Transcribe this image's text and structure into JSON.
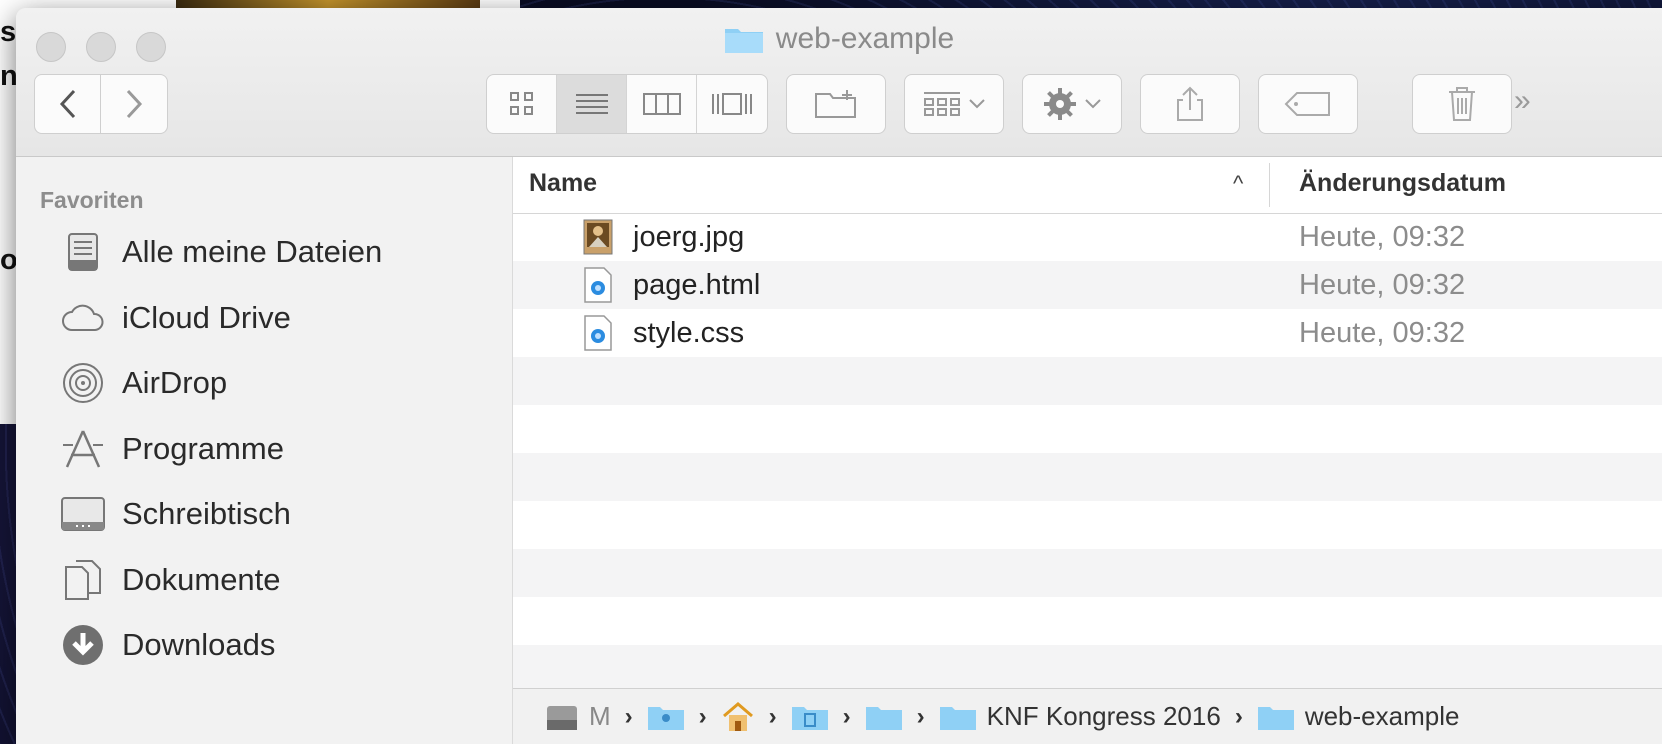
{
  "window": {
    "title": "web-example"
  },
  "background_text": [
    "st",
    "n",
    "or"
  ],
  "toolbar": {
    "more_label": "»"
  },
  "sidebar": {
    "section": "Favoriten",
    "items": [
      {
        "label": "Alle meine Dateien",
        "icon": "all-files-icon"
      },
      {
        "label": "iCloud Drive",
        "icon": "cloud-icon"
      },
      {
        "label": "AirDrop",
        "icon": "airdrop-icon"
      },
      {
        "label": "Programme",
        "icon": "applications-icon"
      },
      {
        "label": "Schreibtisch",
        "icon": "desktop-icon"
      },
      {
        "label": "Dokumente",
        "icon": "documents-icon"
      },
      {
        "label": "Downloads",
        "icon": "downloads-icon"
      }
    ]
  },
  "list": {
    "columns": {
      "name": "Name",
      "date": "Änderungsdatum"
    },
    "rows": [
      {
        "name": "joerg.jpg",
        "date": "Heute, 09:32",
        "icon": "image-file-icon"
      },
      {
        "name": "page.html",
        "date": "Heute, 09:32",
        "icon": "html-file-icon"
      },
      {
        "name": "style.css",
        "date": "Heute, 09:32",
        "icon": "css-file-icon"
      }
    ]
  },
  "pathbar": {
    "disk_label": "M",
    "folders": [
      "KNF Kongress 2016",
      "web-example"
    ]
  }
}
